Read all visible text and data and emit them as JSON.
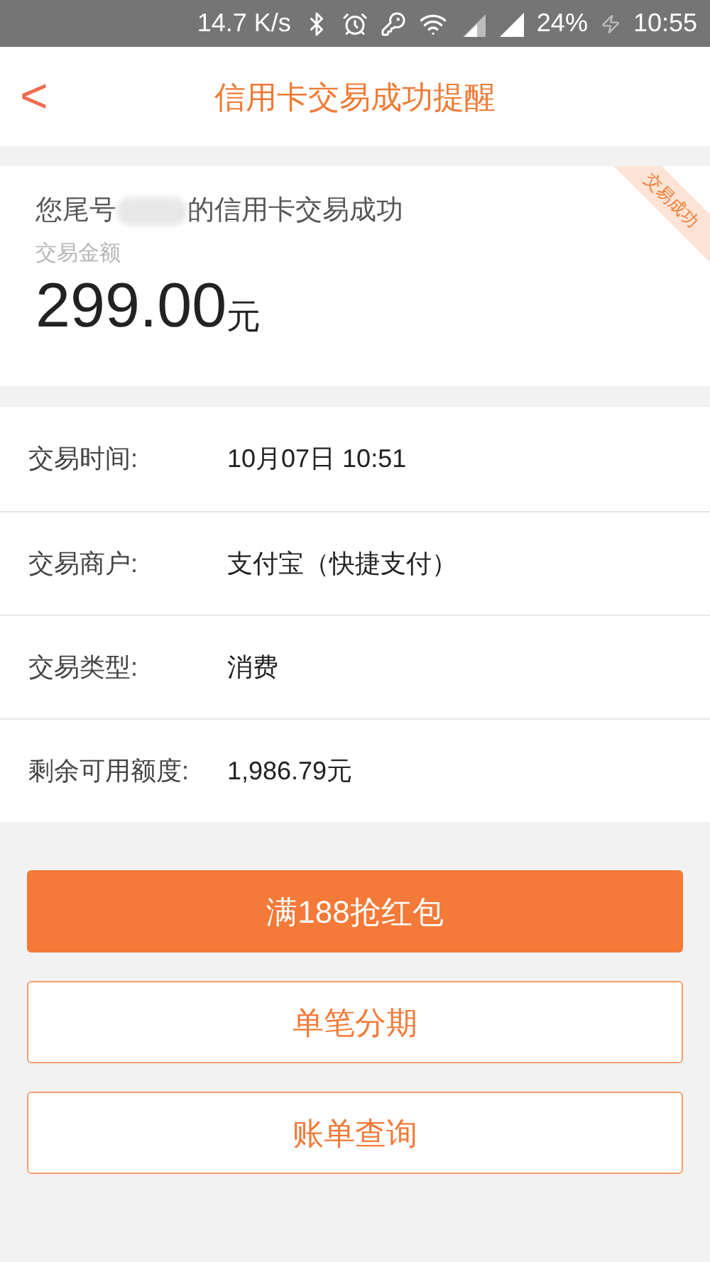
{
  "status_bar": {
    "speed": "14.7 K/s",
    "battery": "24%",
    "time": "10:55"
  },
  "header": {
    "back": "<",
    "title": "信用卡交易成功提醒"
  },
  "summary": {
    "prefix": "您尾号",
    "suffix": "的信用卡交易成功",
    "amount_label": "交易金额",
    "amount": "299.00",
    "unit": "元",
    "ribbon": "交易成功"
  },
  "details": [
    {
      "label": "交易时间:",
      "value": "10月07日 10:51"
    },
    {
      "label": "交易商户:",
      "value": "支付宝（快捷支付）"
    },
    {
      "label": "交易类型:",
      "value": "消费"
    },
    {
      "label": "剩余可用额度:",
      "value": "1,986.79元"
    }
  ],
  "buttons": [
    {
      "label": "满188抢红包",
      "kind": "primary"
    },
    {
      "label": "单笔分期",
      "kind": "outline"
    },
    {
      "label": "账单查询",
      "kind": "outline"
    }
  ]
}
